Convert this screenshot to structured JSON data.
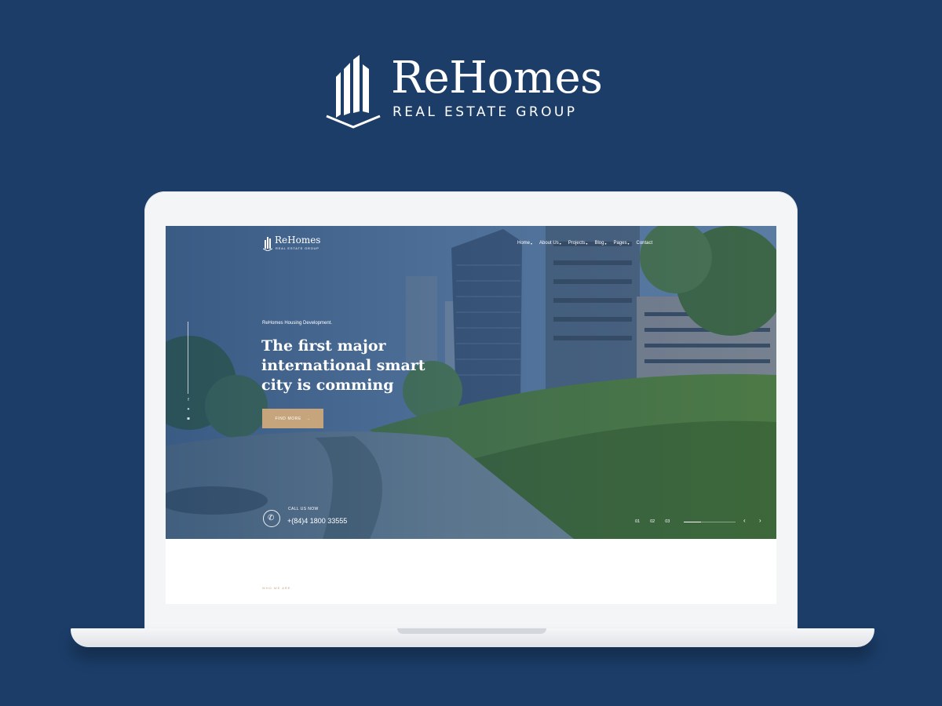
{
  "brand": {
    "name": "ReHomes",
    "tagline": "REAL ESTATE GROUP"
  },
  "site": {
    "logo_name": "ReHomes",
    "logo_tagline": "REAL ESTATE GROUP",
    "nav": [
      {
        "label": "Home",
        "dropdown": true
      },
      {
        "label": "About Us",
        "dropdown": true
      },
      {
        "label": "Projects",
        "dropdown": true
      },
      {
        "label": "Blog",
        "dropdown": true
      },
      {
        "label": "Pages",
        "dropdown": true
      },
      {
        "label": "Contact",
        "dropdown": false
      }
    ],
    "social_icons": [
      "facebook-icon",
      "twitter-icon",
      "instagram-icon"
    ],
    "hero": {
      "eyebrow": "ReHomes Housing Development.",
      "headline": "The first major international smart city is comming",
      "cta": "FIND MORE",
      "call_label": "CALL US NOW",
      "phone": "+(84)4 1800 33555",
      "slides": [
        "01",
        "02",
        "03"
      ],
      "slide_progress": 0.33
    },
    "section": {
      "eyebrow": "WHO WE ARE."
    }
  },
  "colors": {
    "background": "#1b3d68",
    "accent_gold": "#c6a57c",
    "white": "#ffffff"
  }
}
